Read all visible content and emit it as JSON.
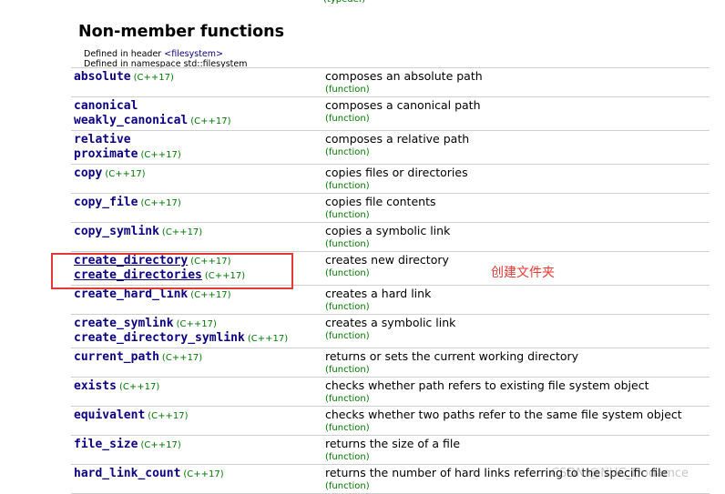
{
  "top_partial": {
    "kind": "(typedef)"
  },
  "section": {
    "heading": "Non-member functions",
    "defined_in_header_prefix": "Defined in header ",
    "defined_in_header_value": "<filesystem>",
    "defined_in_namespace": "Defined in namespace std::filesystem"
  },
  "rows": [
    {
      "names": [
        {
          "name": "absolute",
          "ver": "(C++17)"
        }
      ],
      "desc": "composes an absolute path",
      "kind": "(function)"
    },
    {
      "names": [
        {
          "name": "canonical",
          "ver": ""
        },
        {
          "name": "weakly_canonical",
          "ver": "(C++17)"
        }
      ],
      "desc": "composes a canonical path",
      "kind": "(function)"
    },
    {
      "names": [
        {
          "name": "relative",
          "ver": ""
        },
        {
          "name": "proximate",
          "ver": "(C++17)"
        }
      ],
      "desc": "composes a relative path",
      "kind": "(function)"
    },
    {
      "names": [
        {
          "name": "copy",
          "ver": "(C++17)"
        }
      ],
      "desc": "copies files or directories",
      "kind": "(function)"
    },
    {
      "names": [
        {
          "name": "copy_file",
          "ver": "(C++17)"
        }
      ],
      "desc": "copies file contents",
      "kind": "(function)"
    },
    {
      "names": [
        {
          "name": "copy_symlink",
          "ver": "(C++17)"
        }
      ],
      "desc": "copies a symbolic link",
      "kind": "(function)"
    },
    {
      "names": [
        {
          "name": "create_directory",
          "ver": "(C++17)"
        },
        {
          "name": "create_directories",
          "ver": "(C++17)"
        }
      ],
      "desc": "creates new directory",
      "kind": "(function)"
    },
    {
      "names": [
        {
          "name": "create_hard_link",
          "ver": "(C++17)"
        }
      ],
      "desc": "creates a hard link",
      "kind": "(function)"
    },
    {
      "names": [
        {
          "name": "create_symlink",
          "ver": "(C++17)"
        },
        {
          "name": "create_directory_symlink",
          "ver": "(C++17)"
        }
      ],
      "desc": "creates a symbolic link",
      "kind": "(function)"
    },
    {
      "names": [
        {
          "name": "current_path",
          "ver": "(C++17)"
        }
      ],
      "desc": "returns or sets the current working directory",
      "kind": "(function)"
    },
    {
      "names": [
        {
          "name": "exists",
          "ver": "(C++17)"
        }
      ],
      "desc": "checks whether path refers to existing file system object",
      "kind": "(function)"
    },
    {
      "names": [
        {
          "name": "equivalent",
          "ver": "(C++17)"
        }
      ],
      "desc": "checks whether two paths refer to the same file system object",
      "kind": "(function)"
    },
    {
      "names": [
        {
          "name": "file_size",
          "ver": "(C++17)"
        }
      ],
      "desc": "returns the size of a file",
      "kind": "(function)"
    },
    {
      "names": [
        {
          "name": "hard_link_count",
          "ver": "(C++17)"
        }
      ],
      "desc": "returns the number of hard links referring to the specific file",
      "kind": "(function)"
    }
  ],
  "annotation": {
    "text": "创建文件夹",
    "color": "#e53935"
  },
  "watermark": {
    "text": "CSDN @NUC_Dodamce"
  },
  "colors": {
    "link": "#0b0080",
    "version": "#007700",
    "rule": "#cfcfcf"
  }
}
